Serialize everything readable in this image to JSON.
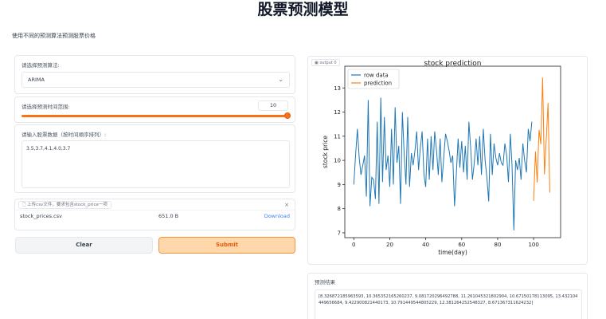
{
  "page": {
    "title": "股票预测模型",
    "description": "使用不同的预测算法预测股票价格"
  },
  "algorithm": {
    "label": "请选择预测算法:",
    "selected": "ARIMA"
  },
  "range": {
    "label": "请选择预测时间范围:",
    "value": "10",
    "fraction": 1.0
  },
  "stock_data": {
    "label": "请输入股票数据（按时间顺序排列）:",
    "value": "3.5,3.7,4.1,4.0,3.7"
  },
  "file": {
    "upload_hint": "上传csv文件，要求包含stock_price一项",
    "close_icon": "×",
    "name": "stock_prices.csv",
    "size": "651.0 B",
    "download": "Download"
  },
  "buttons": {
    "clear": "Clear",
    "submit": "Submit"
  },
  "output": {
    "tag": "output 0"
  },
  "result": {
    "label": "预测结果",
    "value": "[8.326872185963593, 10.365352165260237, 9.081720296492788, 11.261045321802904, 10.67150178113095, 13.432104449656684, 9.422900821440173, 10.791449544805229, 12.381264252548327, 8.671367311624232]"
  },
  "colors": {
    "row_data": "#1f77b4",
    "prediction": "#ff7f0e",
    "accent": "#f97316"
  },
  "chart_data": {
    "type": "line",
    "title": "stock prediction",
    "xlabel": "time(day)",
    "ylabel": "stock price",
    "xlim": [
      -5,
      115
    ],
    "ylim": [
      6.8,
      13.9
    ],
    "xticks": [
      0,
      20,
      40,
      60,
      80,
      100
    ],
    "yticks": [
      7,
      8,
      9,
      10,
      11,
      12,
      13
    ],
    "legend": "top-left",
    "grid": false,
    "series": [
      {
        "name": "row data",
        "color": "#1f77b4",
        "x": [
          0,
          1,
          2,
          3,
          4,
          5,
          6,
          7,
          8,
          9,
          10,
          11,
          12,
          13,
          14,
          15,
          16,
          17,
          18,
          19,
          20,
          21,
          22,
          23,
          24,
          25,
          26,
          27,
          28,
          29,
          30,
          31,
          32,
          33,
          34,
          35,
          36,
          37,
          38,
          39,
          40,
          41,
          42,
          43,
          44,
          45,
          46,
          47,
          48,
          49,
          50,
          51,
          52,
          53,
          54,
          55,
          56,
          57,
          58,
          59,
          60,
          61,
          62,
          63,
          64,
          65,
          66,
          67,
          68,
          69,
          70,
          71,
          72,
          73,
          74,
          75,
          76,
          77,
          78,
          79,
          80,
          81,
          82,
          83,
          84,
          85,
          86,
          87,
          88,
          89,
          90,
          91,
          92,
          93,
          94,
          95,
          96,
          97,
          98,
          99
        ],
        "y": [
          9.0,
          10.2,
          11.3,
          10.1,
          9.4,
          9.8,
          10.2,
          8.5,
          12.5,
          8.1,
          9.3,
          9.2,
          8.4,
          11.6,
          8.2,
          12.6,
          9.1,
          11.8,
          9.6,
          10.2,
          8.9,
          11.3,
          9.0,
          12.2,
          9.9,
          10.6,
          8.2,
          12.0,
          10.3,
          9.0,
          11.8,
          8.9,
          10.3,
          9.8,
          10.4,
          11.2,
          9.6,
          10.5,
          11.2,
          9.4,
          8.9,
          10.9,
          9.2,
          11.0,
          9.6,
          11.2,
          10.4,
          9.4,
          10.9,
          9.1,
          10.1,
          11.1,
          10.8,
          10.4,
          9.9,
          10.2,
          8.1,
          9.4,
          10.9,
          9.7,
          10.8,
          9.5,
          10.6,
          9.2,
          11.6,
          10.5,
          9.2,
          9.9,
          10.9,
          9.8,
          11.0,
          9.4,
          11.3,
          10.0,
          9.3,
          8.3,
          11.1,
          9.4,
          10.7,
          10.1,
          9.8,
          10.3,
          9.9,
          9.8,
          10.7,
          10.2,
          9.1,
          11.1,
          9.8,
          7.1,
          10.0,
          9.6,
          10.1,
          9.2,
          10.7,
          10.0,
          9.5,
          11.3,
          10.8,
          11.6
        ]
      },
      {
        "name": "prediction",
        "color": "#ff7f0e",
        "x": [
          100,
          101,
          102,
          103,
          104,
          105,
          106,
          107,
          108,
          109
        ],
        "y": [
          8.326872185963593,
          10.365352165260237,
          9.081720296492788,
          11.261045321802904,
          10.67150178113095,
          13.432104449656684,
          9.422900821440173,
          10.791449544805229,
          12.381264252548327,
          8.671367311624232
        ]
      }
    ]
  }
}
